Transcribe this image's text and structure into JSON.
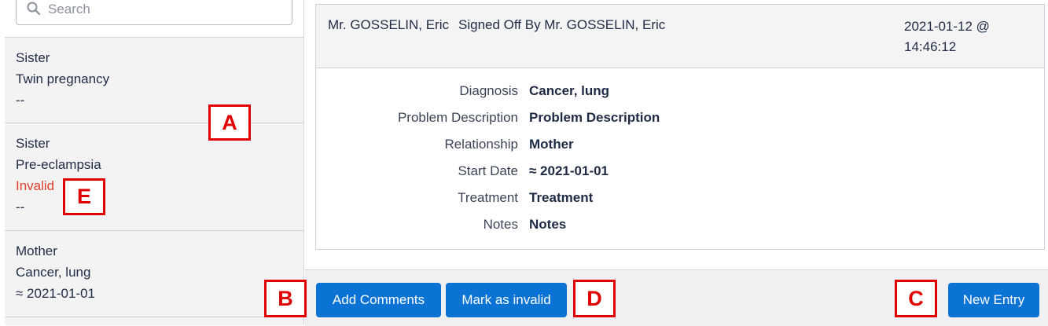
{
  "search": {
    "placeholder": "Search"
  },
  "list": [
    {
      "line1": "Sister",
      "line2": "Twin pregnancy",
      "line3": "--"
    },
    {
      "line1": "Sister",
      "line2": "Pre-eclampsia",
      "status": "Invalid",
      "line3": "--"
    },
    {
      "line1": "Mother",
      "line2": "Cancer, lung",
      "line3": "≈ 2021-01-01"
    }
  ],
  "entry": {
    "author": "Mr. GOSSELIN, Eric",
    "signed_off": "Signed Off By Mr. GOSSELIN, Eric",
    "timestamp": "2021-01-12 @ 14:46:12",
    "fields": [
      {
        "label": "Diagnosis",
        "value": "Cancer, lung"
      },
      {
        "label": "Problem Description",
        "value": "Problem Description"
      },
      {
        "label": "Relationship",
        "value": "Mother"
      },
      {
        "label": "Start Date",
        "value": "≈ 2021-01-01"
      },
      {
        "label": "Treatment",
        "value": "Treatment"
      },
      {
        "label": "Notes",
        "value": "Notes"
      }
    ]
  },
  "footer": {
    "add_comments": "Add Comments",
    "mark_invalid": "Mark as invalid",
    "new_entry": "New Entry"
  },
  "markers": {
    "a": "A",
    "b": "B",
    "c": "C",
    "d": "D",
    "e": "E"
  },
  "colors": {
    "accent": "#0a73d4",
    "invalid": "#e0402a",
    "marker": "#e00000"
  }
}
